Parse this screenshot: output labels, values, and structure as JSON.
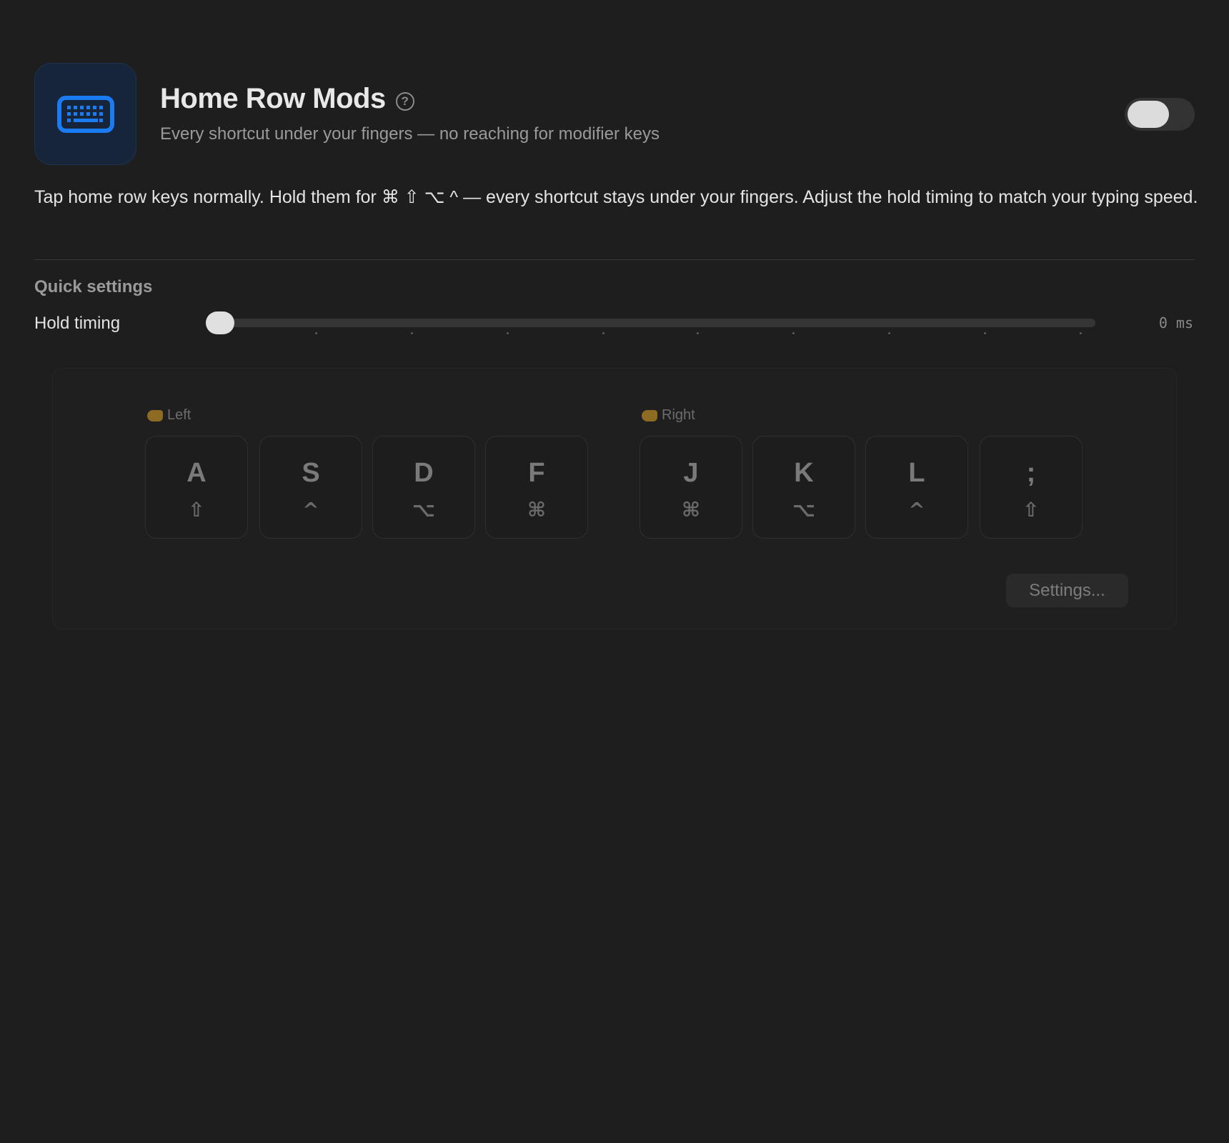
{
  "header": {
    "icon": "keyboard-icon",
    "title": "Home Row Mods",
    "help_icon": "question-mark-icon",
    "help_glyph": "?",
    "subtitle": "Every shortcut under your fingers — no reaching for modifier keys",
    "enabled": false
  },
  "description": "Tap home row keys normally. Hold them for ⌘ ⇧ ⌥ ^ — every shortcut stays under your fingers. Adjust the hold timing to match your typing speed.",
  "quick_settings": {
    "section_label": "Quick settings",
    "hold_timing_label": "Hold timing",
    "hold_timing_value": 0,
    "hold_timing_display": "0 ms"
  },
  "keyboard": {
    "left_label": "Left",
    "right_label": "Right",
    "hand_icon": "pointing-hand-icon",
    "left_keys": [
      {
        "letter": "A",
        "modifier": "⇧",
        "modifier_name": "shift"
      },
      {
        "letter": "S",
        "modifier": "^",
        "modifier_name": "control"
      },
      {
        "letter": "D",
        "modifier": "⌥",
        "modifier_name": "option"
      },
      {
        "letter": "F",
        "modifier": "⌘",
        "modifier_name": "command"
      }
    ],
    "right_keys": [
      {
        "letter": "J",
        "modifier": "⌘",
        "modifier_name": "command"
      },
      {
        "letter": "K",
        "modifier": "⌥",
        "modifier_name": "option"
      },
      {
        "letter": "L",
        "modifier": "^",
        "modifier_name": "control"
      },
      {
        "letter": ";",
        "modifier": "⇧",
        "modifier_name": "shift"
      }
    ],
    "settings_button": "Settings..."
  },
  "colors": {
    "background": "#1e1e1e",
    "accent_icon": "#1a73e8",
    "hand_emoji": "#8d6b22"
  }
}
